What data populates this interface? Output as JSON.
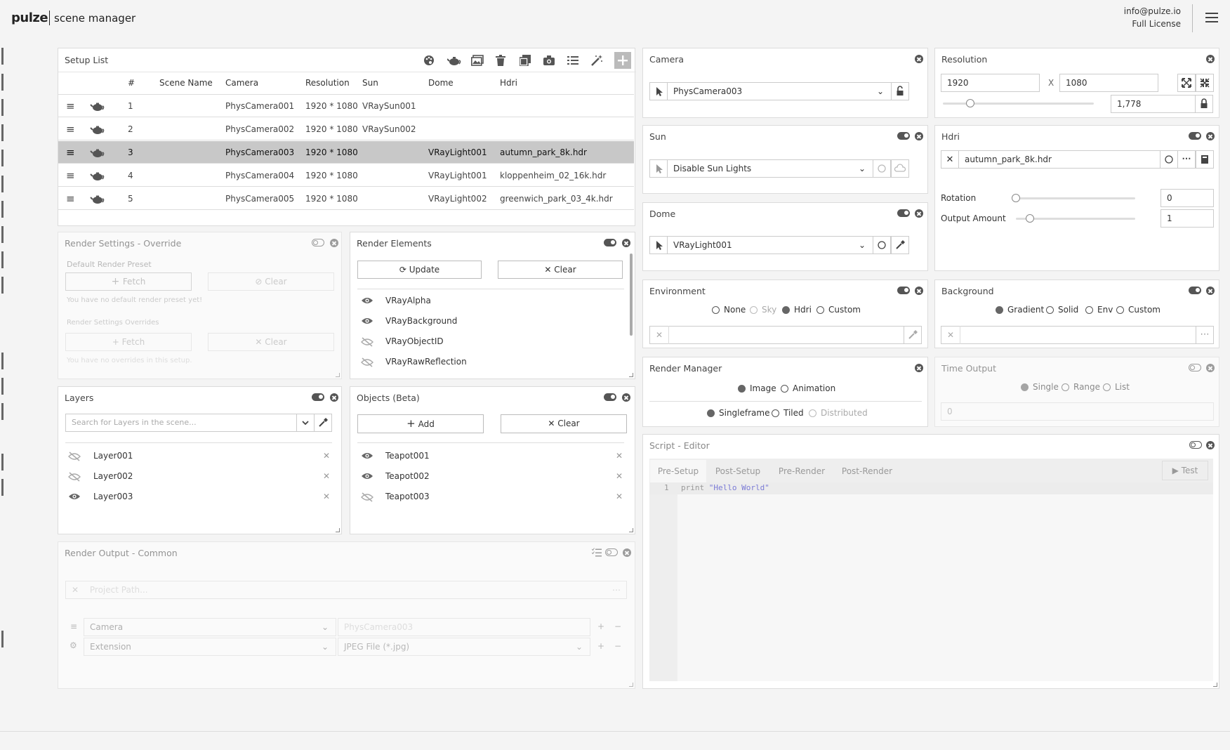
{
  "header": {
    "logo": "pulze",
    "subtitle": "scene manager",
    "email": "info@pulze.io",
    "license": "Full License"
  },
  "sidebar": {
    "items": [
      "camera-icon",
      "image-icon",
      "gear-icon",
      "light-bulb-icon",
      "rectangle-icon",
      "trees-icon",
      "triangle-icon",
      "clock-icon",
      "nodes-icon",
      "file-icon",
      "document-icon",
      "document-lines-icon",
      "calculator-icon",
      "hierarchy-icon",
      "signature-icon",
      "layers-icon",
      "teapots-icon",
      "wind-icon",
      "link-icon",
      "file-settings-icon",
      "list-icon",
      "note-icon",
      "file-code-icon",
      "code-icon",
      "bug-icon"
    ]
  },
  "setup_list": {
    "title": "Setup List",
    "columns": [
      "#",
      "Scene Name",
      "Camera",
      "Resolution",
      "Sun",
      "Dome",
      "Hdri"
    ],
    "rows": [
      {
        "num": "1",
        "scene": "",
        "camera": "PhysCamera001",
        "resolution": "1920 * 1080",
        "sun": "VRaySun001",
        "dome": "",
        "hdri": ""
      },
      {
        "num": "2",
        "scene": "",
        "camera": "PhysCamera002",
        "resolution": "1920 * 1080",
        "sun": "VRaySun002",
        "dome": "",
        "hdri": ""
      },
      {
        "num": "3",
        "scene": "",
        "camera": "PhysCamera003",
        "resolution": "1920 * 1080",
        "sun": "",
        "dome": "VRayLight001",
        "hdri": "autumn_park_8k.hdr"
      },
      {
        "num": "4",
        "scene": "",
        "camera": "PhysCamera004",
        "resolution": "1920 * 1080",
        "sun": "",
        "dome": "VRayLight001",
        "hdri": "kloppenheim_02_16k.hdr"
      },
      {
        "num": "5",
        "scene": "",
        "camera": "PhysCamera005",
        "resolution": "1920 * 1080",
        "sun": "",
        "dome": "VRayLight002",
        "hdri": "greenwich_park_03_4k.hdr"
      }
    ],
    "selected_row": 3
  },
  "render_settings": {
    "title": "Render Settings - Override",
    "default_label": "Default Render Preset",
    "fetch": "Fetch",
    "clear": "Clear",
    "no_default": "You have no default render preset yet!",
    "overrides_label": "Render Settings Overrides",
    "no_overrides": "You have no overrides in this setup."
  },
  "render_elements": {
    "title": "Render Elements",
    "update": "Update",
    "clear": "Clear",
    "items": [
      {
        "name": "VRayAlpha",
        "visible": true
      },
      {
        "name": "VRayBackground",
        "visible": true
      },
      {
        "name": "VRayObjectID",
        "visible": false
      },
      {
        "name": "VRayRawReflection",
        "visible": false
      }
    ]
  },
  "layers": {
    "title": "Layers",
    "search_placeholder": "Search for Layers in the scene...",
    "items": [
      {
        "name": "Layer001",
        "visible": false
      },
      {
        "name": "Layer002",
        "visible": false
      },
      {
        "name": "Layer003",
        "visible": true
      }
    ]
  },
  "objects": {
    "title": "Objects (Beta)",
    "add": "Add",
    "clear": "Clear",
    "items": [
      {
        "name": "Teapot001",
        "visible": true
      },
      {
        "name": "Teapot002",
        "visible": true
      },
      {
        "name": "Teapot003",
        "visible": false
      }
    ]
  },
  "render_output": {
    "title": "Render Output - Common",
    "path_placeholder": "Project Path...",
    "camera_label": "Camera",
    "camera_value": "PhysCamera003",
    "extension_label": "Extension",
    "extension_value": "JPEG File (*.jpg)"
  },
  "camera": {
    "title": "Camera",
    "value": "PhysCamera003"
  },
  "sun": {
    "title": "Sun",
    "value": "Disable Sun Lights"
  },
  "dome": {
    "title": "Dome",
    "value": "VRayLight001"
  },
  "environment": {
    "title": "Environment",
    "options": [
      "None",
      "Sky",
      "Hdri",
      "Custom"
    ],
    "selected": "Hdri"
  },
  "render_manager": {
    "title": "Render Manager",
    "type_options": [
      "Image",
      "Animation"
    ],
    "type_selected": "Image",
    "mode_options": [
      "Singleframe",
      "Tiled",
      "Distributed"
    ],
    "mode_selected": "Singleframe"
  },
  "resolution": {
    "title": "Resolution",
    "width": "1920",
    "height": "1080",
    "x": "X",
    "aspect": "1,778",
    "slider_fraction": 0.18
  },
  "hdri": {
    "title": "Hdri",
    "file": "autumn_park_8k.hdr",
    "rotation_label": "Rotation",
    "rotation": "0",
    "rotation_fraction": 0.0,
    "output_label": "Output Amount",
    "output": "1",
    "output_fraction": 0.12
  },
  "background": {
    "title": "Background",
    "options": [
      "Gradient",
      "Solid",
      "Env",
      "Custom"
    ],
    "selected": "Gradient"
  },
  "time_output": {
    "title": "Time Output",
    "options": [
      "Single",
      "Range",
      "List"
    ],
    "selected": "Single",
    "value": "0"
  },
  "script_editor": {
    "title": "Script - Editor",
    "tabs": [
      "Pre-Setup",
      "Post-Setup",
      "Pre-Render",
      "Post-Render"
    ],
    "active_tab": "Pre-Setup",
    "test": "Test",
    "line_no": "1",
    "code_kw": "print",
    "code_str": "\"Hello World\""
  },
  "colors": {
    "accent": "#555555",
    "selected_row": "#c8c8c8",
    "code_string": "#7b7bd6"
  }
}
